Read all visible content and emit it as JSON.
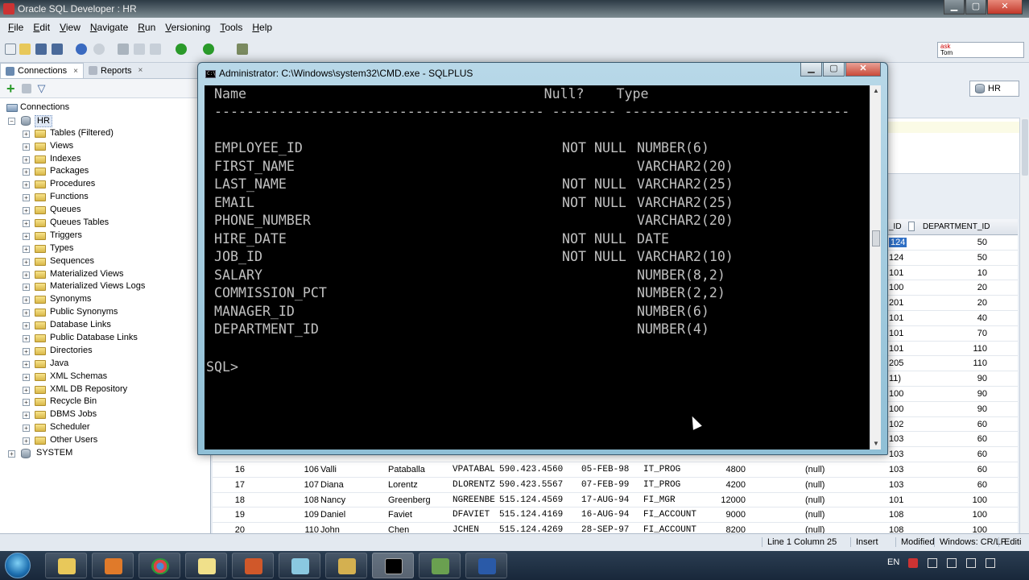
{
  "window": {
    "title": "Oracle SQL Developer : HR"
  },
  "menu": [
    "File",
    "Edit",
    "View",
    "Navigate",
    "Run",
    "Versioning",
    "Tools",
    "Help"
  ],
  "asktom": {
    "line1": "ask",
    "line2": "Tom"
  },
  "left_tabs": {
    "connections": "Connections",
    "reports": "Reports",
    "close": "×"
  },
  "tree": {
    "root": "Connections",
    "hr": "HR",
    "items": [
      "Tables (Filtered)",
      "Views",
      "Indexes",
      "Packages",
      "Procedures",
      "Functions",
      "Queues",
      "Queues Tables",
      "Triggers",
      "Types",
      "Sequences",
      "Materialized Views",
      "Materialized Views Logs",
      "Synonyms",
      "Public Synonyms",
      "Database Links",
      "Public Database Links",
      "Directories",
      "Java",
      "XML Schemas",
      "XML DB Repository",
      "Recycle Bin",
      "DBMS Jobs",
      "Scheduler",
      "Other Users"
    ],
    "system": "SYSTEM"
  },
  "connection_tab": "HR",
  "grid": {
    "headers": {
      "manager_id": "_ID",
      "department_id": "DEPARTMENT_ID"
    },
    "partial_rows": [
      {
        "mgr": "124",
        "dept": "50"
      },
      {
        "mgr": "124",
        "dept": "50"
      },
      {
        "mgr": "101",
        "dept": "10"
      },
      {
        "mgr": "100",
        "dept": "20"
      },
      {
        "mgr": "201",
        "dept": "20"
      },
      {
        "mgr": "101",
        "dept": "40"
      },
      {
        "mgr": "101",
        "dept": "70"
      },
      {
        "mgr": "101",
        "dept": "110"
      },
      {
        "mgr": "205",
        "dept": "110"
      },
      {
        "mgr": "11)",
        "dept": "90"
      },
      {
        "mgr": "100",
        "dept": "90"
      },
      {
        "mgr": "100",
        "dept": "90"
      },
      {
        "mgr": "102",
        "dept": "60"
      },
      {
        "mgr": "103",
        "dept": "60"
      },
      {
        "mgr": "103",
        "dept": "60"
      }
    ],
    "full_rows": [
      {
        "n": "16",
        "id": "106",
        "first": "Valli",
        "last": "Pataballa",
        "email": "VPATABAL",
        "phone": "590.423.4560",
        "hire": "05-FEB-98",
        "job": "IT_PROG",
        "salary": "4800",
        "comm": "(null)",
        "mgr": "103",
        "dept": "60"
      },
      {
        "n": "17",
        "id": "107",
        "first": "Diana",
        "last": "Lorentz",
        "email": "DLORENTZ",
        "phone": "590.423.5567",
        "hire": "07-FEB-99",
        "job": "IT_PROG",
        "salary": "4200",
        "comm": "(null)",
        "mgr": "103",
        "dept": "60"
      },
      {
        "n": "18",
        "id": "108",
        "first": "Nancy",
        "last": "Greenberg",
        "email": "NGREENBE",
        "phone": "515.124.4569",
        "hire": "17-AUG-94",
        "job": "FI_MGR",
        "salary": "12000",
        "comm": "(null)",
        "mgr": "101",
        "dept": "100"
      },
      {
        "n": "19",
        "id": "109",
        "first": "Daniel",
        "last": "Faviet",
        "email": "DFAVIET",
        "phone": "515.124.4169",
        "hire": "16-AUG-94",
        "job": "FI_ACCOUNT",
        "salary": "9000",
        "comm": "(null)",
        "mgr": "108",
        "dept": "100"
      },
      {
        "n": "20",
        "id": "110",
        "first": "John",
        "last": "Chen",
        "email": "JCHEN",
        "phone": "515.124.4269",
        "hire": "28-SEP-97",
        "job": "FI_ACCOUNT",
        "salary": "8200",
        "comm": "(null)",
        "mgr": "108",
        "dept": "100"
      }
    ]
  },
  "status": {
    "position": "Line 1 Column 25",
    "mode": "Insert",
    "modified": "Modified",
    "eol": "Windows: CR/LF",
    "edit": "Editi"
  },
  "cmd": {
    "title": "Administrator: C:\\Windows\\system32\\CMD.exe - SQLPLUS",
    "icon_text": "C:\\",
    "header": " Name                                     Null?    Type",
    "divider": " ----------------------------------------- -------- ----------------------------",
    "columns": [
      {
        "name": "EMPLOYEE_ID",
        "null": "NOT NULL",
        "type": "NUMBER(6)"
      },
      {
        "name": "FIRST_NAME",
        "null": "",
        "type": "VARCHAR2(20)"
      },
      {
        "name": "LAST_NAME",
        "null": "NOT NULL",
        "type": "VARCHAR2(25)"
      },
      {
        "name": "EMAIL",
        "null": "NOT NULL",
        "type": "VARCHAR2(25)"
      },
      {
        "name": "PHONE_NUMBER",
        "null": "",
        "type": "VARCHAR2(20)"
      },
      {
        "name": "HIRE_DATE",
        "null": "NOT NULL",
        "type": "DATE"
      },
      {
        "name": "JOB_ID",
        "null": "NOT NULL",
        "type": "VARCHAR2(10)"
      },
      {
        "name": "SALARY",
        "null": "",
        "type": "NUMBER(8,2)"
      },
      {
        "name": "COMMISSION_PCT",
        "null": "",
        "type": "NUMBER(2,2)"
      },
      {
        "name": "MANAGER_ID",
        "null": "",
        "type": "NUMBER(6)"
      },
      {
        "name": "DEPARTMENT_ID",
        "null": "",
        "type": "NUMBER(4)"
      }
    ],
    "prompt": "SQL>"
  },
  "taskbar": {
    "lang": "EN"
  }
}
